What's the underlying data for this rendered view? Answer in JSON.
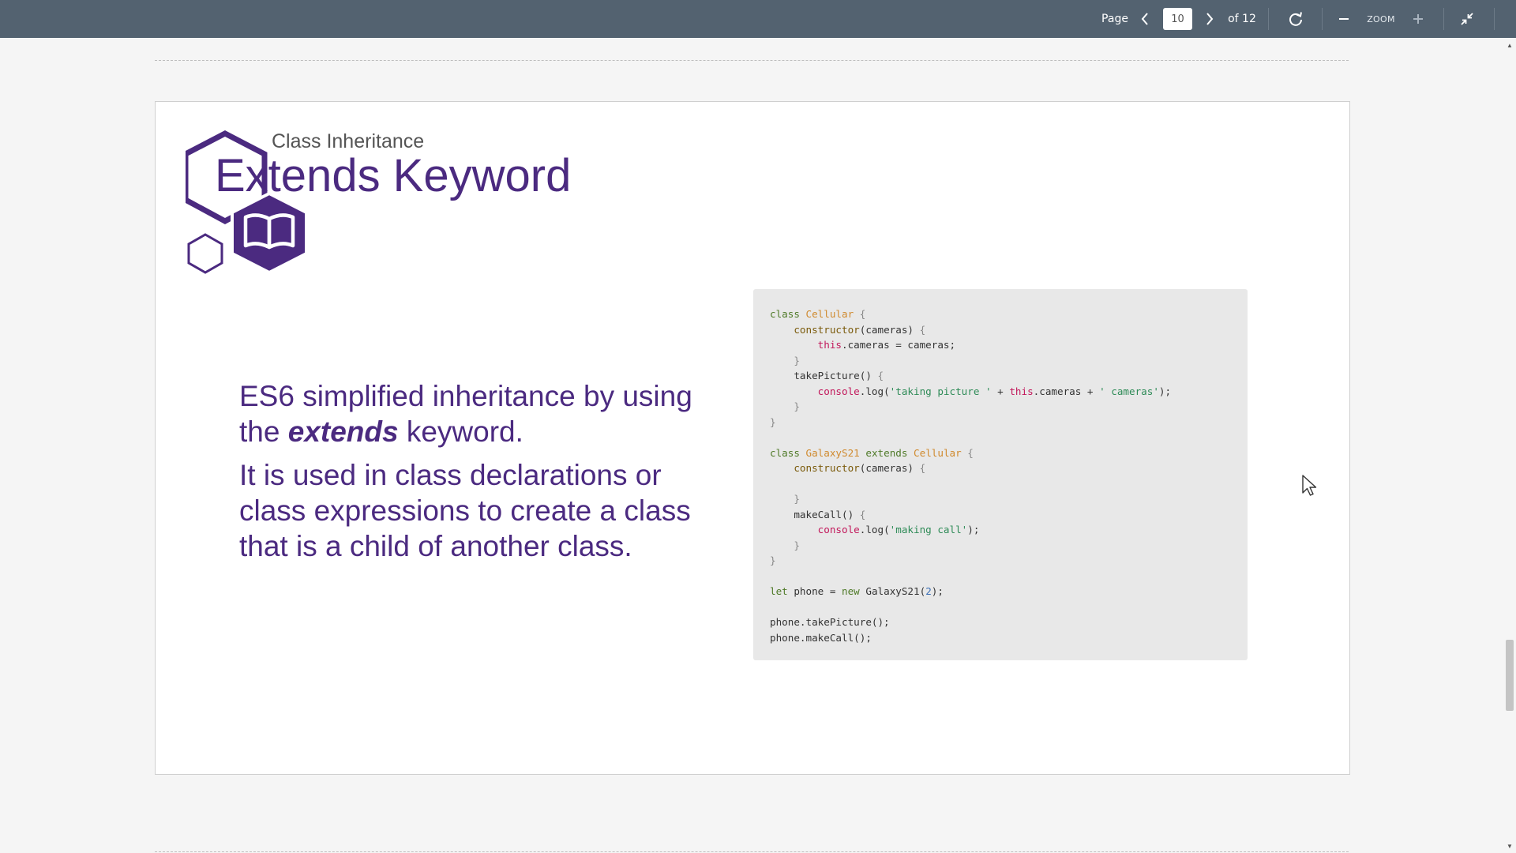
{
  "toolbar": {
    "page_label": "Page",
    "prev_icon": "chevron-left-icon",
    "current_page": "10",
    "next_icon": "chevron-right-icon",
    "page_total": "of 12",
    "rotate_icon": "rotate-icon",
    "zoom_out_icon": "minus-icon",
    "zoom_label": "ZOOM",
    "zoom_in_icon": "plus-icon",
    "exit_fullscreen_icon": "collapse-icon"
  },
  "slide": {
    "subtitle": "Class Inheritance",
    "title": "Extends Keyword",
    "logo_icon": "book-hexagon-icon",
    "paragraph1_before": "ES6 simplified inheritance by using the ",
    "paragraph1_emphasis": "extends",
    "paragraph1_after": " keyword.",
    "paragraph2": "It is used in class declarations or class expressions to create a class that is a child of another class.",
    "code": {
      "kw_class": "class",
      "kw_extends": "extends",
      "kw_let": "let",
      "kw_new": "new",
      "kw_this": "this",
      "cls_cellular": "Cellular",
      "cls_galaxy": "GalaxyS21",
      "fn_constructor": "constructor",
      "fn_take_picture": "takePicture",
      "fn_make_call": "makeCall",
      "param_cameras": "cameras",
      "prop_cameras": ".cameras = cameras;",
      "prop_cameras_ref": ".cameras + ",
      "console": "console",
      "log": ".log(",
      "str_taking_picture": "'taking picture '",
      "str_cameras": "' cameras'",
      "str_making_call": "'making call'",
      "let_phone": "phone = ",
      "new_galaxy": "GalaxyS21(",
      "num_two": "2",
      "call_take_picture": "phone.takePicture();",
      "call_make_call": "phone.makeCall();"
    }
  },
  "colors": {
    "toolbar_bg": "#536270",
    "accent_purple": "#4b2a80",
    "code_bg": "#e8e8e8"
  }
}
